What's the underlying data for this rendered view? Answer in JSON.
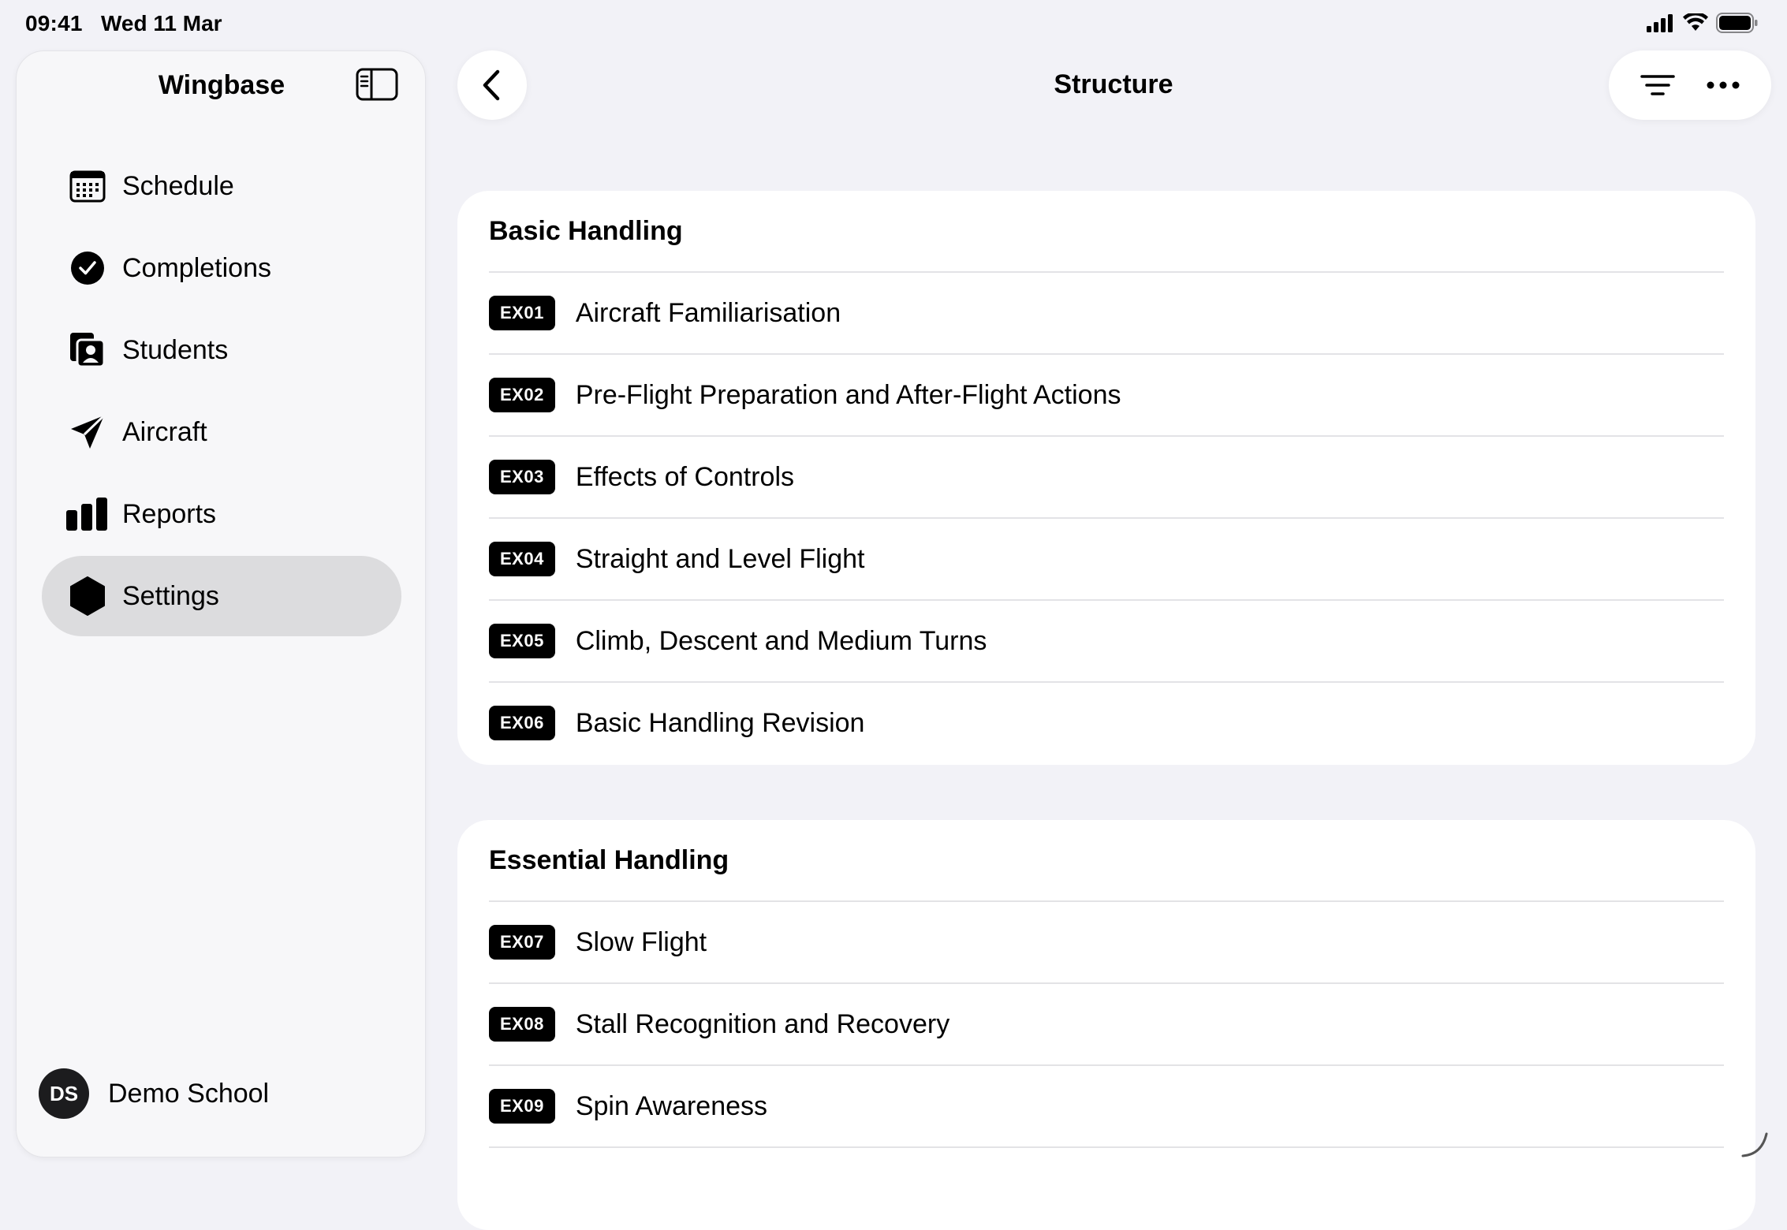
{
  "status_bar": {
    "time": "09:41",
    "date": "Wed 11 Mar"
  },
  "sidebar": {
    "title": "Wingbase",
    "items": [
      {
        "label": "Schedule",
        "icon": "calendar-icon"
      },
      {
        "label": "Completions",
        "icon": "checkmark-circle-icon"
      },
      {
        "label": "Students",
        "icon": "person-cards-icon"
      },
      {
        "label": "Aircraft",
        "icon": "paperplane-icon"
      },
      {
        "label": "Reports",
        "icon": "bar-chart-icon"
      },
      {
        "label": "Settings",
        "icon": "hexagon-icon",
        "active": true
      }
    ],
    "profile": {
      "initials": "DS",
      "name": "Demo School"
    }
  },
  "header": {
    "title": "Structure"
  },
  "sections": [
    {
      "title": "Basic Handling",
      "rows": [
        {
          "code": "EX01",
          "label": "Aircraft Familiarisation"
        },
        {
          "code": "EX02",
          "label": "Pre-Flight Preparation and After-Flight Actions"
        },
        {
          "code": "EX03",
          "label": "Effects of Controls"
        },
        {
          "code": "EX04",
          "label": "Straight and Level Flight"
        },
        {
          "code": "EX05",
          "label": "Climb, Descent and Medium Turns"
        },
        {
          "code": "EX06",
          "label": "Basic Handling Revision"
        }
      ]
    },
    {
      "title": "Essential Handling",
      "rows": [
        {
          "code": "EX07",
          "label": "Slow Flight"
        },
        {
          "code": "EX08",
          "label": "Stall Recognition and Recovery"
        },
        {
          "code": "EX09",
          "label": "Spin Awareness"
        }
      ]
    }
  ]
}
